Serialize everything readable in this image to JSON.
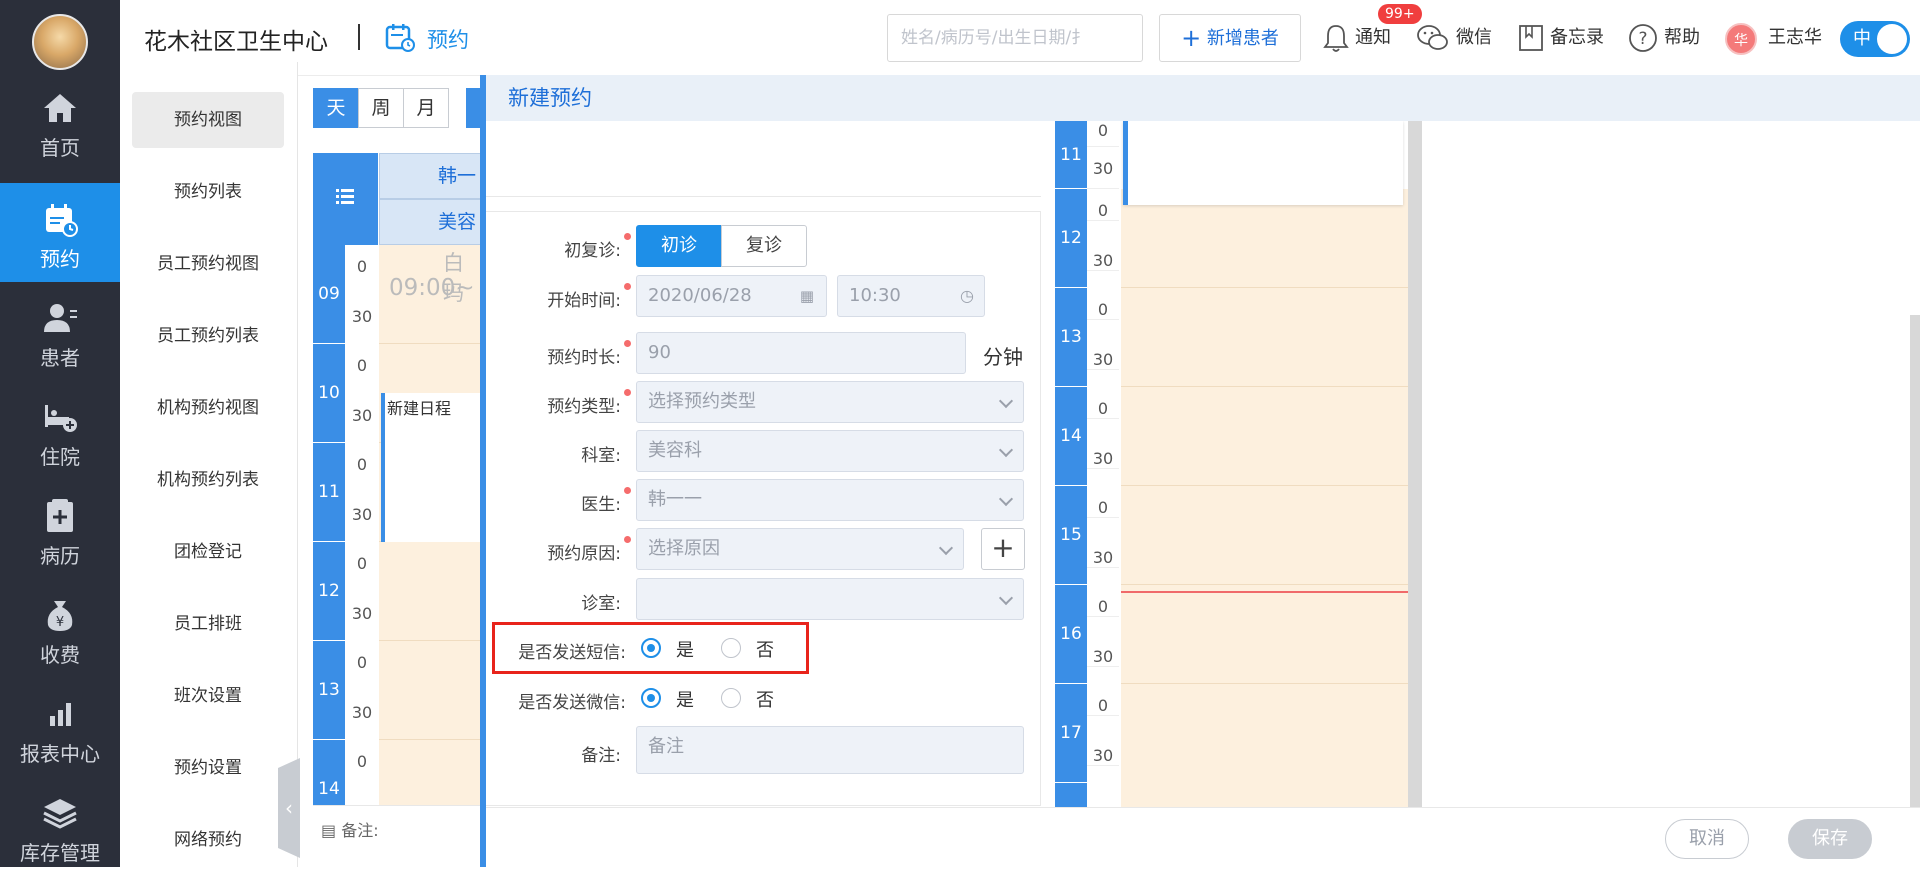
{
  "org_name": "花木社区卫生中心",
  "current_module": "预约",
  "nav": [
    {
      "label": "首页",
      "icon": "home-icon"
    },
    {
      "label": "预约",
      "icon": "calendar-icon",
      "active": true
    },
    {
      "label": "患者",
      "icon": "patient-icon"
    },
    {
      "label": "住院",
      "icon": "bed-icon"
    },
    {
      "label": "病历",
      "icon": "medical-record-icon"
    },
    {
      "label": "收费",
      "icon": "money-bag-icon"
    },
    {
      "label": "报表中心",
      "icon": "bar-chart-icon"
    },
    {
      "label": "库存管理",
      "icon": "layers-icon"
    }
  ],
  "submenu": [
    "预约视图",
    "预约列表",
    "员工预约视图",
    "员工预约列表",
    "机构预约视图",
    "机构预约列表",
    "团检登记",
    "员工排班",
    "班次设置",
    "预约设置",
    "网络预约"
  ],
  "header": {
    "search_placeholder": "姓名/病历号/出生日期/扌",
    "add_patient": "新增患者",
    "notify": "通知",
    "notify_badge": "99+",
    "wechat": "微信",
    "memo": "备忘录",
    "help": "帮助",
    "user_name": "王志华",
    "user_avatar_text": "华",
    "lang_toggle": "中"
  },
  "calendar_bg": {
    "view_tabs": [
      "天",
      "周",
      "月"
    ],
    "doctor_header": "韩一",
    "dept_header": "美容",
    "event_title_1": "白玛",
    "event_time_1": "09:00~",
    "event_new": "新建日程",
    "hours": [
      "09",
      "10",
      "11",
      "12",
      "13",
      "14"
    ],
    "min0": "0",
    "min30": "30",
    "note_label": "备注:"
  },
  "modal": {
    "title": "新建预约",
    "visit_type_label": "初复诊:",
    "visit_first": "初诊",
    "visit_return": "复诊",
    "start_label": "开始时间:",
    "start_date": "2020/06/28",
    "start_time": "10:30",
    "duration_label": "预约时长:",
    "duration": "90",
    "duration_unit": "分钟",
    "type_label": "预约类型:",
    "type_placeholder": "选择预约类型",
    "dept_label": "科室:",
    "dept_value": "美容科",
    "doctor_label": "医生:",
    "doctor_value": "韩一一",
    "reason_label": "预约原因:",
    "reason_placeholder": "选择原因",
    "room_label": "诊室:",
    "sms_label": "是否发送短信:",
    "wechat_label": "是否发送微信:",
    "yes": "是",
    "no": "否",
    "remark_label": "备注:",
    "remark_placeholder": "备注",
    "cancel": "取消",
    "save": "保存"
  },
  "schedule": {
    "hours": [
      "11",
      "12",
      "13",
      "14",
      "15",
      "16",
      "17"
    ],
    "min0": "0",
    "min30": "30"
  }
}
